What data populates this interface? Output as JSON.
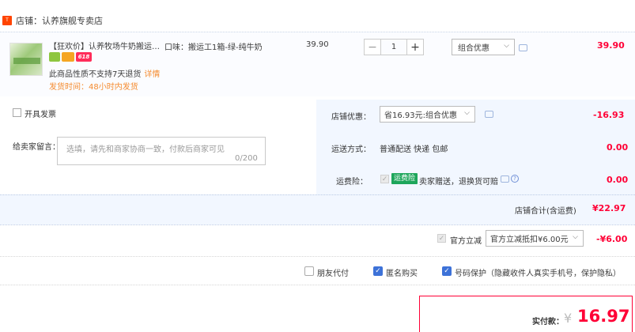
{
  "shop": {
    "label": "店铺：认养旗舰专卖店"
  },
  "item": {
    "title": "【狂欢价】认养牧场牛奶搬运工...",
    "tag_text": "618",
    "attribute": "口味：搬运工1箱-绿-纯牛奶",
    "unit_price": "39.90",
    "return_note": "此商品性质不支持7天退货",
    "return_link": "详情",
    "ship_time": "发货时间：48小时内发货",
    "quantity": "1",
    "minus": "−",
    "plus": "+",
    "promo": "组合优惠",
    "total": "39.90"
  },
  "invoice": {
    "label": "开具发票"
  },
  "message": {
    "label": "给卖家留言：",
    "placeholder": "选填，请先和商家协商一致，付款后商家可见",
    "count": "0/200"
  },
  "store_discount": {
    "label": "店铺优惠：",
    "option": "省16.93元:组合优惠",
    "amount": "-16.93"
  },
  "shipping": {
    "label": "运送方式：",
    "value": "普通配送 快递 包邮",
    "amount": "0.00"
  },
  "insurance": {
    "label": "运费险：",
    "badge": "运费险",
    "text": "卖家赠送，退换货可赔",
    "amount": "0.00"
  },
  "store_total": {
    "label": "店铺合计(含运费)",
    "amount": "¥22.97"
  },
  "cross_discount": {
    "label": "官方立减",
    "option": "官方立减抵扣¥6.00元",
    "amount": "-¥6.00"
  },
  "options": [
    {
      "label": "朋友代付",
      "checked": false
    },
    {
      "label": "匿名购买",
      "checked": true
    },
    {
      "label": "号码保护（隐藏收件人真实手机号，保护隐私）",
      "checked": true
    }
  ],
  "payment": {
    "label": "实付款：",
    "currency": "¥",
    "amount": "16.97"
  },
  "colors": {
    "accent": "#ff0036",
    "orange": "#f58b2f",
    "blue": "#3d72d8",
    "panel": "#f2f7ff"
  },
  "icons": {
    "dropdown": "chevron-down-icon",
    "chat": "chat-icon",
    "help": "help-icon",
    "check": "check-icon"
  }
}
